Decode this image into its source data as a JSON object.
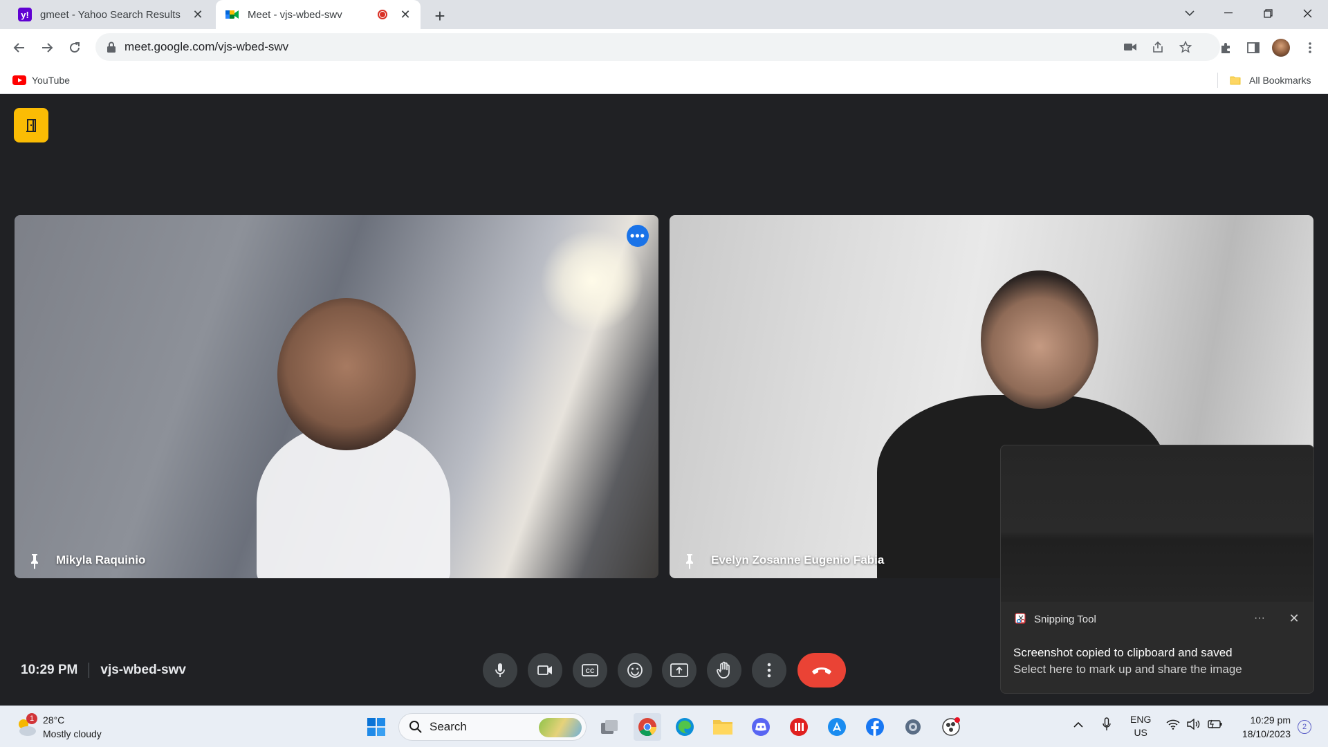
{
  "browser": {
    "tabs": [
      {
        "title": "gmeet - Yahoo Search Results",
        "active": false
      },
      {
        "title": "Meet - vjs-wbed-swv",
        "active": true
      }
    ],
    "url": "meet.google.com/vjs-wbed-swv",
    "bookmarks": [
      {
        "label": "YouTube"
      }
    ],
    "all_bookmarks_label": "All Bookmarks"
  },
  "meet": {
    "participants": [
      {
        "name": "Mikyla Raquinio"
      },
      {
        "name": "Evelyn Zosanne Eugenio Fabia"
      }
    ],
    "time": "10:29 PM",
    "meeting_code": "vjs-wbed-swv",
    "colors": {
      "end_call": "#ea4335",
      "accent": "#1a73e8",
      "background": "#202124"
    }
  },
  "toast": {
    "app_name": "Snipping Tool",
    "message_title": "Screenshot copied to clipboard and saved",
    "message_body": "Select here to mark up and share the image"
  },
  "taskbar": {
    "weather": {
      "temp": "28°C",
      "condition": "Mostly cloudy",
      "badge": "1"
    },
    "search_label": "Search",
    "language": {
      "line1": "ENG",
      "line2": "US"
    },
    "clock": {
      "time": "10:29 pm",
      "date": "18/10/2023"
    },
    "notifications": "2"
  }
}
